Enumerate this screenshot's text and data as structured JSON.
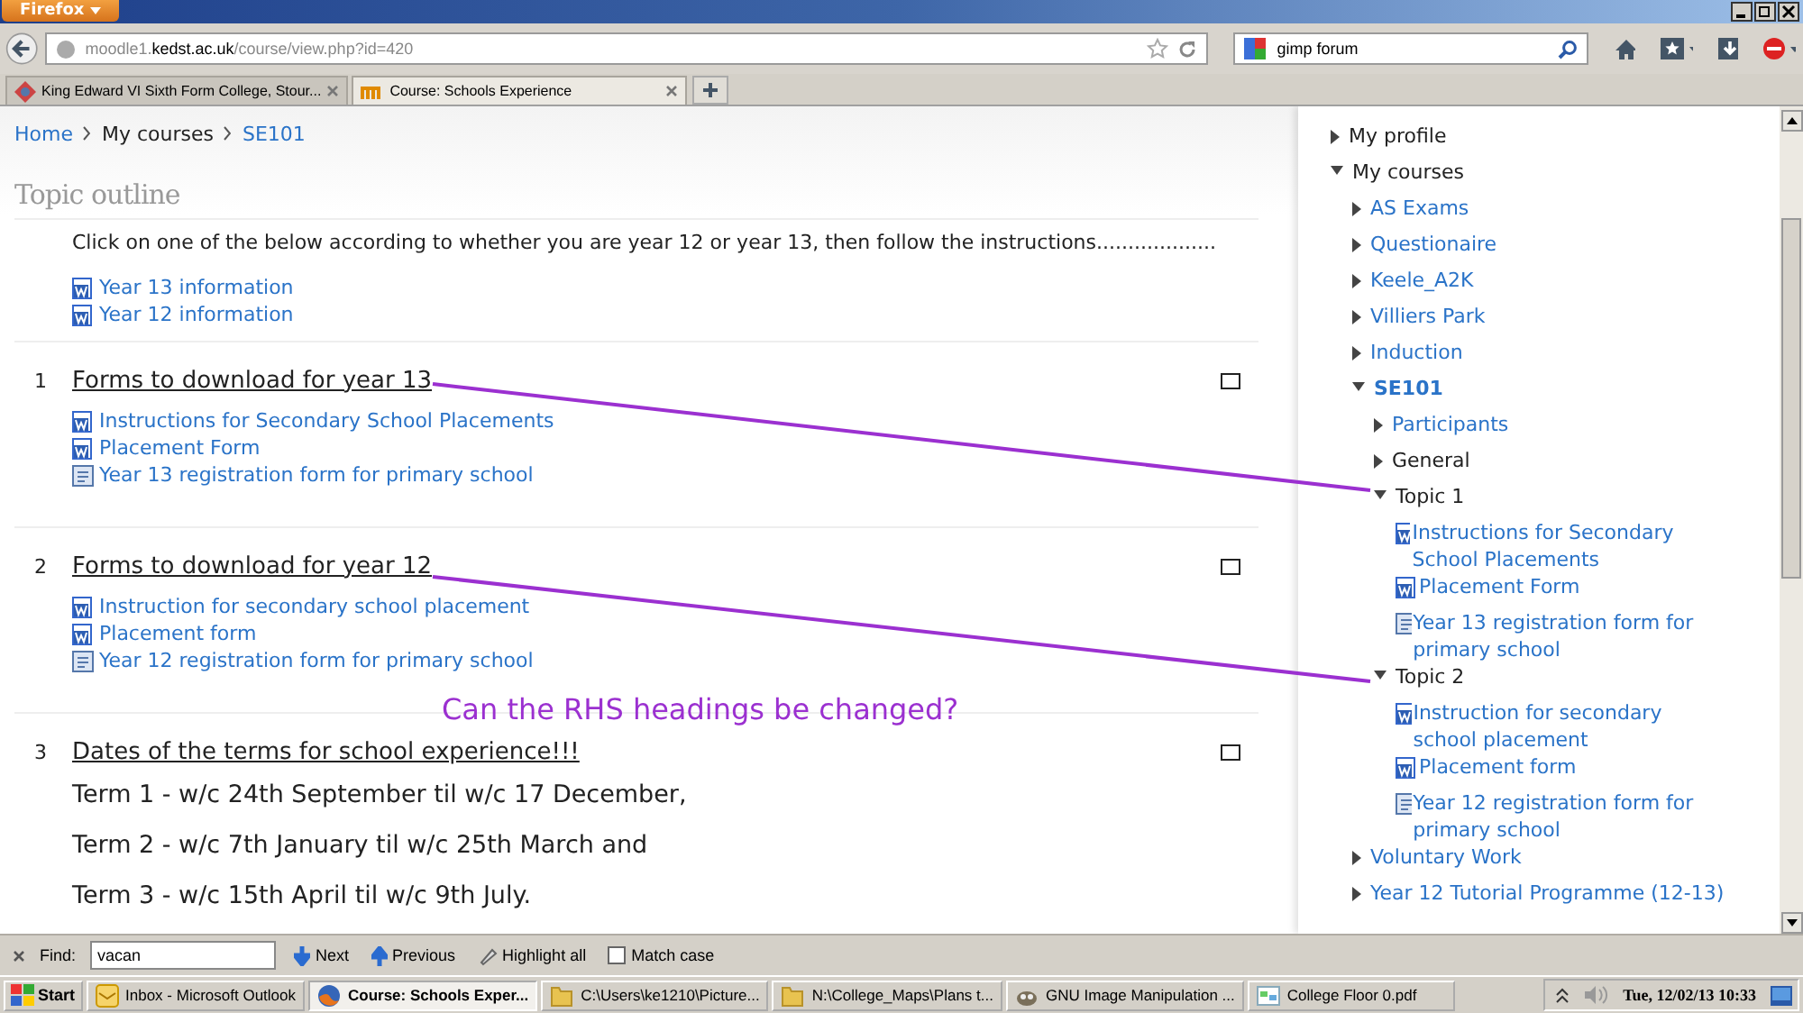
{
  "browser": {
    "menu_button": "Firefox",
    "url": "moodle1.**kedst.ac.uk**/course/view.php?id=420",
    "search": "gimp forum",
    "tabs": [
      {
        "label": "King Edward VI Sixth Form College, Stour...",
        "selected": false
      },
      {
        "label": "Course: Schools Experience",
        "selected": true
      }
    ]
  },
  "breadcrumb": [
    {
      "label": "Home",
      "link": true
    },
    {
      "label": "My courses",
      "link": false
    },
    {
      "label": "SE101",
      "link": true
    }
  ],
  "page_title": "Topic outline",
  "intro": {
    "text": "Click on one of the below according to whether you are year 12 or year 13, then follow the instructions...................",
    "items": [
      {
        "label": "Year 13 information",
        "kind": "doc"
      },
      {
        "label": "Year 12 information",
        "kind": "doc"
      }
    ]
  },
  "sections": [
    {
      "number": "1",
      "heading": "Forms to download for year 13",
      "items": [
        {
          "label": "Instructions for Secondary School Placements",
          "kind": "doc"
        },
        {
          "label": "Placement Form",
          "kind": "doc"
        },
        {
          "label": "Year 13 registration form for primary school",
          "kind": "form"
        }
      ]
    },
    {
      "number": "2",
      "heading": "Forms to download for year 12",
      "items": [
        {
          "label": "Instruction for secondary school placement",
          "kind": "doc"
        },
        {
          "label": "Placement form",
          "kind": "doc"
        },
        {
          "label": "Year 12 registration form for primary school",
          "kind": "form"
        }
      ]
    },
    {
      "number": "3",
      "heading": "Dates of the terms for school experience!!!",
      "lines": [
        "Term 1 - w/c 24th September til w/c 17 December,",
        "Term 2 - w/c 7th January til w/c 25th March and",
        "Term 3 - w/c 15th April til w/c 9th July."
      ]
    }
  ],
  "annotation": "Can the RHS headings be changed?",
  "nav_tree": [
    {
      "label": "My profile",
      "kind": "branch",
      "expanded": false,
      "link": false
    },
    {
      "label": "My courses",
      "kind": "branch",
      "expanded": true,
      "link": false,
      "children": [
        {
          "label": "AS Exams",
          "kind": "branch",
          "expanded": false,
          "link": true
        },
        {
          "label": "Questionaire",
          "kind": "branch",
          "expanded": false,
          "link": true
        },
        {
          "label": "Keele_A2K",
          "kind": "branch",
          "expanded": false,
          "link": true
        },
        {
          "label": "Villiers Park",
          "kind": "branch",
          "expanded": false,
          "link": true
        },
        {
          "label": "Induction",
          "kind": "branch",
          "expanded": false,
          "link": true
        },
        {
          "label": "SE101",
          "kind": "branch",
          "expanded": true,
          "link": true,
          "current": true,
          "children": [
            {
              "label": "Participants",
              "kind": "branch",
              "expanded": false,
              "link": true
            },
            {
              "label": "General",
              "kind": "branch",
              "expanded": false,
              "link": false
            },
            {
              "label": "Topic 1",
              "kind": "branch",
              "expanded": true,
              "link": false,
              "children": [
                {
                  "label": "Instructions for Secondary School Placements",
                  "kind": "doc",
                  "link": true
                },
                {
                  "label": "Placement Form",
                  "kind": "doc",
                  "link": true
                },
                {
                  "label": "Year 13 registration form for primary school",
                  "kind": "form",
                  "link": true
                }
              ]
            },
            {
              "label": "Topic 2",
              "kind": "branch",
              "expanded": true,
              "link": false,
              "children": [
                {
                  "label": "Instruction for secondary school placement",
                  "kind": "doc",
                  "link": true
                },
                {
                  "label": "Placement form",
                  "kind": "doc",
                  "link": true
                },
                {
                  "label": "Year 12 registration form for primary school",
                  "kind": "form",
                  "link": true
                }
              ]
            }
          ]
        },
        {
          "label": "Voluntary Work",
          "kind": "branch",
          "expanded": false,
          "link": true
        },
        {
          "label": "Year 12 Tutorial Programme (12-13)",
          "kind": "branch",
          "expanded": false,
          "link": true
        }
      ]
    }
  ],
  "find_bar": {
    "label": "Find:",
    "value": "vacan",
    "next": "Next",
    "previous": "Previous",
    "highlight": "Highlight all",
    "match_case": {
      "label": "Match case",
      "checked": false
    }
  },
  "taskbar": {
    "start": "Start",
    "tasks": [
      {
        "label": "Inbox - Microsoft Outlook",
        "selected": false,
        "kind": "mail"
      },
      {
        "label": "Course: Schools Exper...",
        "selected": true,
        "kind": "browser"
      },
      {
        "label": "C:\\Users\\ke1210\\Picture...",
        "selected": false,
        "kind": "folder"
      },
      {
        "label": "N:\\College_Maps\\Plans t...",
        "selected": false,
        "kind": "folder"
      },
      {
        "label": "GNU Image Manipulation ...",
        "selected": false,
        "kind": "gimp"
      },
      {
        "label": "College Floor 0.pdf",
        "selected": false,
        "kind": "pdf"
      }
    ],
    "clock": "Tue, 12/02/13 10:33"
  }
}
